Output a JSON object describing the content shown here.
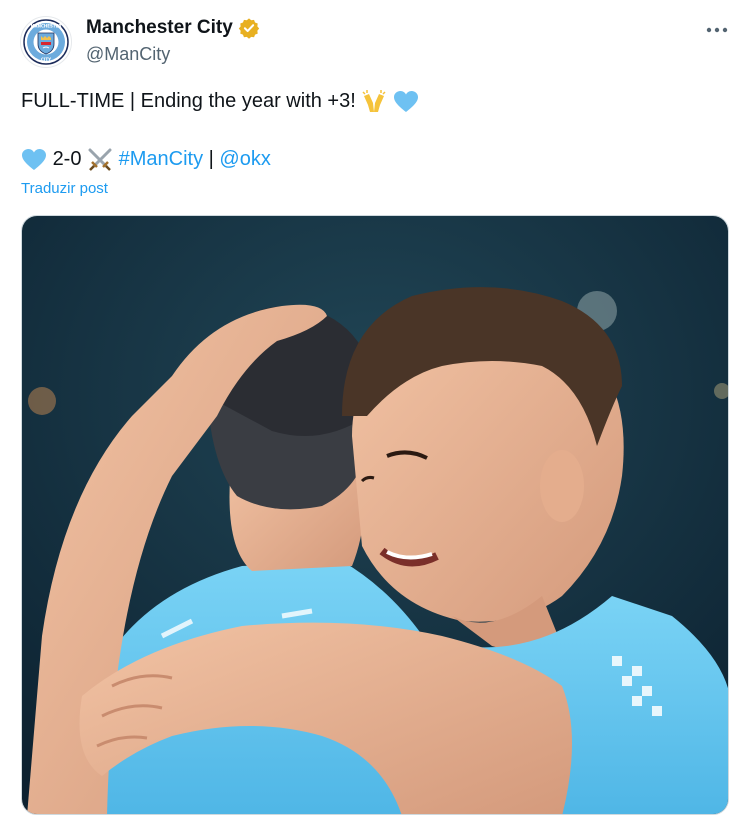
{
  "author": {
    "display_name": "Manchester City",
    "handle": "@ManCity",
    "verified_badge_color": "#e8b021",
    "avatar_icon": "man-city-crest-icon",
    "crest_text_top": "MANCHESTER",
    "crest_text_bottom": "CITY"
  },
  "menu": {
    "more_icon": "more-options-icon"
  },
  "tweet": {
    "line1_text": "FULL-TIME | Ending the year with +3!",
    "line1_emojis": [
      "raising-hands-emoji",
      "light-blue-heart-emoji"
    ],
    "line2_emoji": "light-blue-heart-emoji",
    "line2_score": "2-0",
    "line2_emoji2": "crossed-swords-emoji",
    "hashtag": "#ManCity",
    "separator": "|",
    "mention": "@okx"
  },
  "translate_link": "Traduzir post",
  "media": {
    "alt": "photo-two-players-celebrating",
    "jersey_color": "#6ccaf0",
    "background_color": "#0f2a3a"
  },
  "colors": {
    "link": "#1d9bf0",
    "text": "#0f1419",
    "secondary_text": "#536471",
    "heart_blue": "#6ec1f2"
  }
}
